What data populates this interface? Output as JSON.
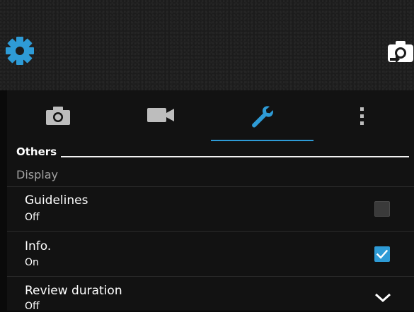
{
  "colors": {
    "accent": "#2e9bd6",
    "panel": "#121212"
  },
  "top_controls": {
    "settings_icon": "gear-icon",
    "switch_camera_icon": "switch-camera-icon"
  },
  "tabs": [
    {
      "icon": "camera-icon",
      "selected": false
    },
    {
      "icon": "video-camera-icon",
      "selected": false
    },
    {
      "icon": "wrench-icon",
      "selected": true
    },
    {
      "icon": "more-vertical-icon",
      "selected": false
    }
  ],
  "section": {
    "title": "Others"
  },
  "category": {
    "label": "Display"
  },
  "settings": [
    {
      "title": "Guidelines",
      "value": "Off",
      "control": "checkbox",
      "checked": false
    },
    {
      "title": "Info.",
      "value": "On",
      "control": "checkbox",
      "checked": true
    },
    {
      "title": "Review duration",
      "value": "Off",
      "control": "dropdown"
    }
  ]
}
